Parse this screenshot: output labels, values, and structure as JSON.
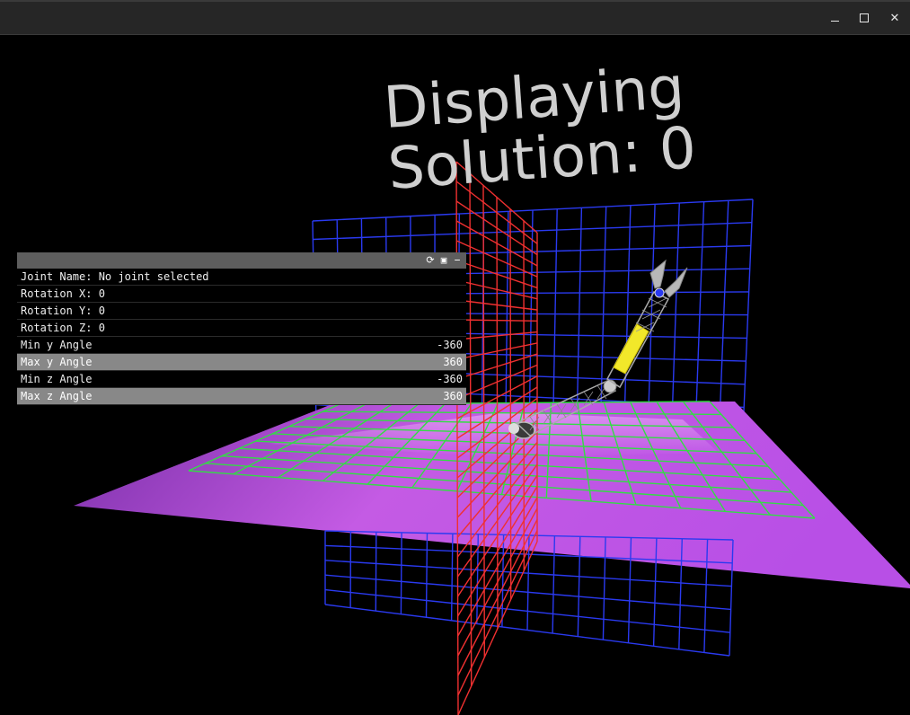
{
  "window": {
    "minimize_glyph": "minimize-icon",
    "maximize_glyph": "maximize-icon",
    "close_glyph": "close-icon",
    "close_label": "✕"
  },
  "viewport": {
    "overlay_line1": "Displaying",
    "overlay_line2": "Solution: 0",
    "colors": {
      "ground_plane": "#c152e0",
      "xz_grid": "#33dd44",
      "xy_grid": "#2a3af0",
      "yz_grid": "#f03030",
      "arm_highlight": "#f2e82a"
    }
  },
  "panel": {
    "icons": [
      "refresh-icon",
      "save-icon",
      "collapse-icon"
    ],
    "joint_name": "Joint Name: No joint selected",
    "rotation_x": "Rotation X: 0",
    "rotation_y": "Rotation Y: 0",
    "rotation_z": "Rotation Z: 0",
    "min_y": {
      "label": "Min y Angle",
      "value": "-360"
    },
    "max_y": {
      "label": "Max y Angle",
      "value": "360"
    },
    "min_z": {
      "label": "Min z Angle",
      "value": "-360"
    },
    "max_z": {
      "label": "Max z Angle",
      "value": "360"
    }
  }
}
